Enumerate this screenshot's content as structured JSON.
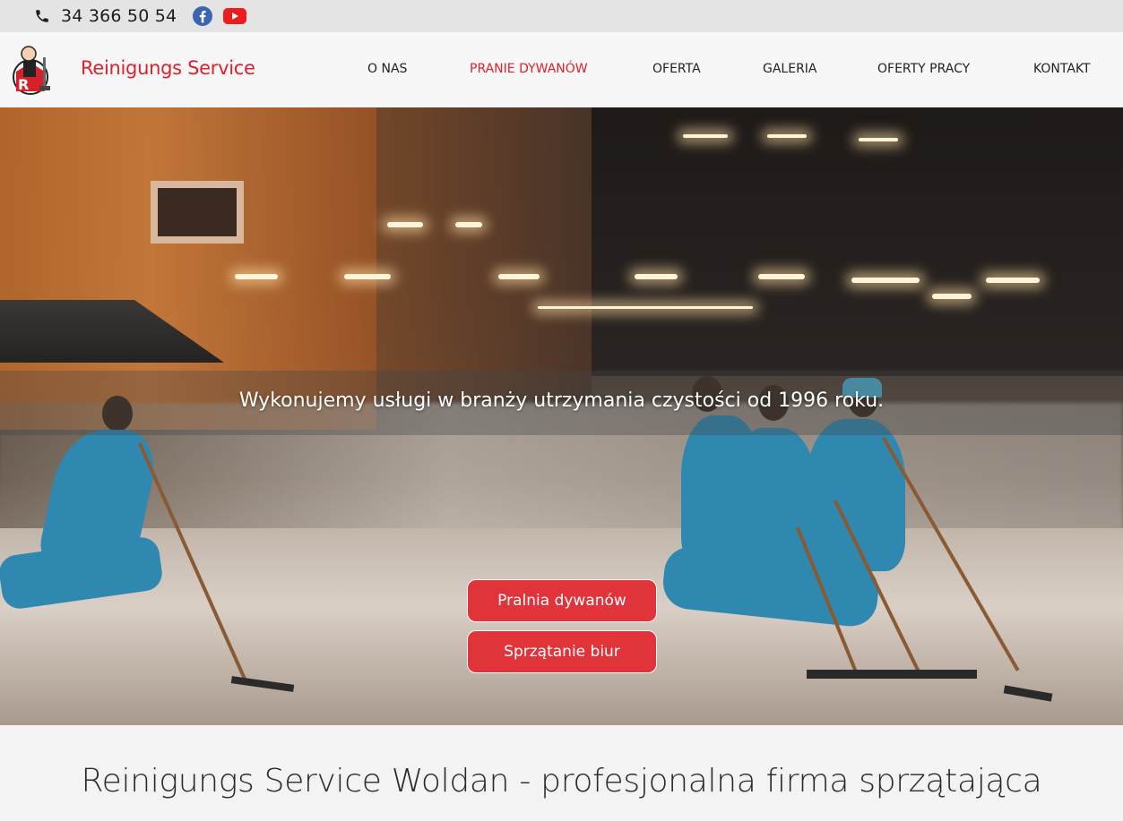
{
  "topbar": {
    "phone": "34 366 50 54",
    "icons": [
      "phone-icon",
      "facebook-icon",
      "youtube-icon"
    ]
  },
  "header": {
    "brand": "Reinigungs Service",
    "nav": [
      {
        "label": "O NAS",
        "active": false
      },
      {
        "label": "PRANIE DYWANÓW",
        "active": true
      },
      {
        "label": "OFERTA",
        "active": false
      },
      {
        "label": "GALERIA",
        "active": false
      },
      {
        "label": "OFERTY PRACY",
        "active": false
      },
      {
        "label": "KONTAKT",
        "active": false
      }
    ]
  },
  "hero": {
    "tagline": "Wykonujemy usługi w branży utrzymania czystości od 1996 roku.",
    "buttons": [
      "Pralnia dywanów",
      "Sprzątanie biur"
    ]
  },
  "main": {
    "title": "Reinigungs Service Woldan - profesjonalna firma sprzątająca"
  },
  "colors": {
    "accent": "#e0202a",
    "button": "#e0333a",
    "topbar": "#e4e4e4",
    "header": "#f7f7f7"
  }
}
